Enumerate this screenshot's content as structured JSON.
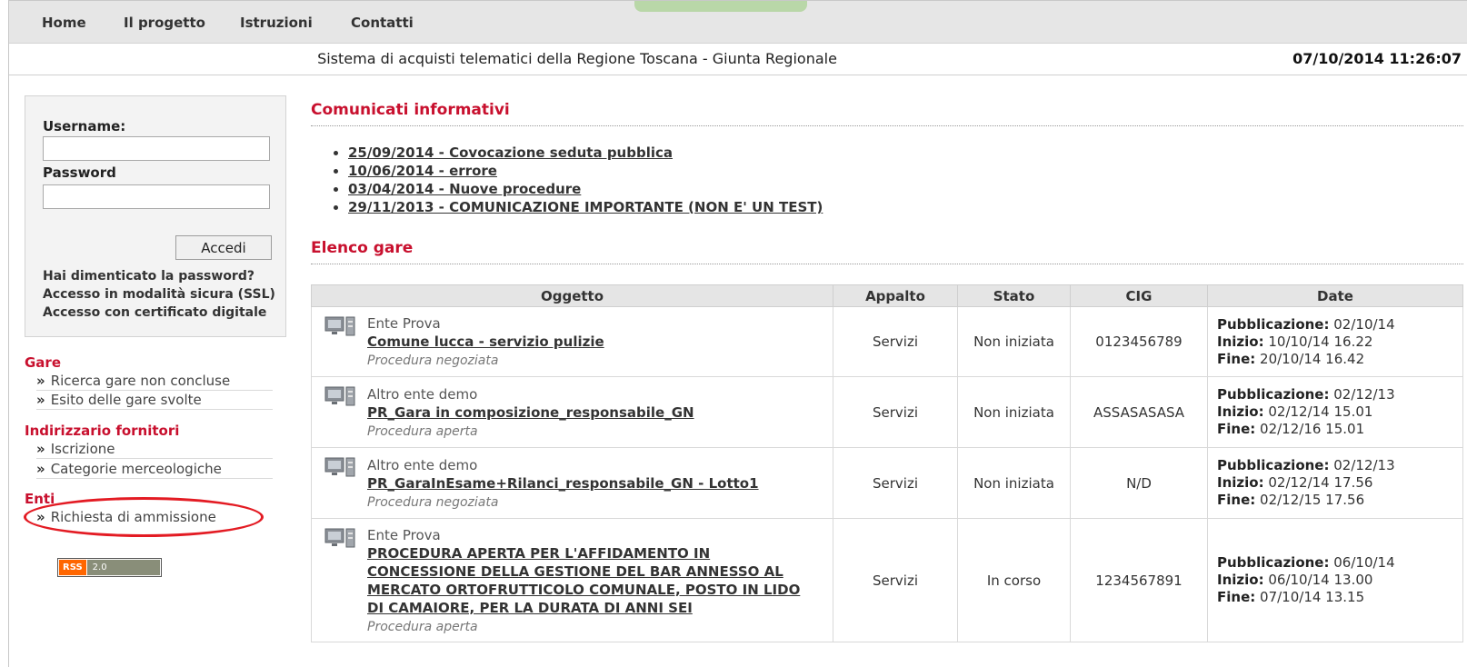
{
  "nav": {
    "items": [
      "Home",
      "Il progetto",
      "Istruzioni",
      "Contatti"
    ]
  },
  "header": {
    "title": "Sistema di acquisti telematici della Regione Toscana - Giunta Regionale",
    "datetime": "07/10/2014 11:26:07"
  },
  "login": {
    "username_label": "Username:",
    "password_label": "Password",
    "username_value": "",
    "password_value": "",
    "submit_label": "Accedi",
    "links": [
      "Hai dimenticato la password?",
      "Accesso in modalità sicura (SSL)",
      "Accesso con certificato digitale"
    ]
  },
  "sidebar": {
    "sections": [
      {
        "title": "Gare",
        "items": [
          "Ricerca gare non concluse",
          "Esito delle gare svolte"
        ]
      },
      {
        "title": "Indirizzario fornitori",
        "items": [
          "Iscrizione",
          "Categorie merceologiche"
        ]
      },
      {
        "title": "Enti",
        "items": [
          "Richiesta di ammissione"
        ]
      }
    ],
    "arrow_glyph": "»",
    "highlight_color": "#e31b23"
  },
  "rss": {
    "left": "RSS",
    "right": "2.0"
  },
  "comunicati": {
    "title": "Comunicati informativi",
    "items": [
      "25/09/2014 - Covocazione seduta pubblica",
      "10/06/2014 - errore",
      "03/04/2014 - Nuove procedure",
      "29/11/2013 - COMUNICAZIONE IMPORTANTE (NON E' UN TEST)"
    ]
  },
  "gare": {
    "title": "Elenco gare",
    "columns": [
      "Oggetto",
      "Appalto",
      "Stato",
      "CIG",
      "Date"
    ],
    "date_labels": {
      "pub": "Pubblicazione:",
      "inizio": "Inizio:",
      "fine": "Fine:"
    },
    "rows": [
      {
        "ente": "Ente Prova",
        "titolo": "Comune lucca - servizio pulizie",
        "procedura": "Procedura negoziata",
        "appalto": "Servizi",
        "stato": "Non iniziata",
        "cig": "0123456789",
        "pub": "02/10/14",
        "inizio": "10/10/14 16.22",
        "fine": "20/10/14 16.42"
      },
      {
        "ente": "Altro ente demo",
        "titolo": "PR_Gara in composizione_responsabile_GN",
        "procedura": "Procedura aperta",
        "appalto": "Servizi",
        "stato": "Non iniziata",
        "cig": "ASSASASASA",
        "pub": "02/12/13",
        "inizio": "02/12/14 15.01",
        "fine": "02/12/16 15.01"
      },
      {
        "ente": "Altro ente demo",
        "titolo": "PR_GaraInEsame+Rilanci_responsabile_GN - Lotto1",
        "procedura": "Procedura negoziata",
        "appalto": "Servizi",
        "stato": "Non iniziata",
        "cig": "N/D",
        "pub": "02/12/13",
        "inizio": "02/12/14 17.56",
        "fine": "02/12/15 17.56"
      },
      {
        "ente": "Ente Prova",
        "titolo": "PROCEDURA APERTA PER L'AFFIDAMENTO IN CONCESSIONE DELLA GESTIONE DEL BAR ANNESSO AL MERCATO ORTOFRUTTICOLO COMUNALE, POSTO IN LIDO DI CAMAIORE, PER LA DURATA DI ANNI SEI",
        "procedura": "Procedura aperta",
        "appalto": "Servizi",
        "stato": "In corso",
        "cig": "1234567891",
        "pub": "06/10/14",
        "inizio": "06/10/14 13.00",
        "fine": "07/10/14 13.15"
      }
    ]
  }
}
